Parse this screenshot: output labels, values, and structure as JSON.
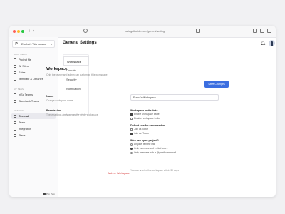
{
  "browser": {
    "url": "partagalbuilder.com/general setting"
  },
  "sidebar": {
    "workspace": {
      "logo": "P",
      "name": "Eunha's Workspace"
    },
    "sections": [
      {
        "title": "MAIN MENU",
        "items": [
          {
            "label": "Project file"
          },
          {
            "label": "All Sites"
          },
          {
            "label": "Sales"
          },
          {
            "label": "Template & Libraries"
          }
        ]
      },
      {
        "title": "MY TEAM",
        "items": [
          {
            "label": "IriSq Teams"
          },
          {
            "label": "Shopifank Teams"
          }
        ]
      },
      {
        "title": "SETTING",
        "items": [
          {
            "label": "General"
          },
          {
            "label": "Team"
          },
          {
            "label": "Integration"
          },
          {
            "label": "Plans"
          }
        ]
      }
    ],
    "user": {
      "name": "Pim Pam"
    }
  },
  "header": {
    "title": "General Settings"
  },
  "subnav": {
    "tabs": [
      {
        "label": "Workspace"
      },
      {
        "label": "Domain"
      },
      {
        "label": "Security"
      },
      {
        "label": "Notification"
      }
    ]
  },
  "workspace": {
    "title": "Workspace",
    "subtitle": "Only the owner and admin can customize this workspace",
    "save_label": "Save Changes",
    "name_label": "Name",
    "name_help": "Change workspace name",
    "name_value": "Eunha's Workspace",
    "permission_label": "Permission",
    "permission_help": "These settings apply across the whole workspace",
    "invite": {
      "title": "Workspace invite links",
      "options": [
        "Enable workspace invite",
        "Disable workspace invite"
      ],
      "selected": 0
    },
    "default_role": {
      "title": "Default role for new member",
      "options": [
        "Join as Editor",
        "Join as Viewer"
      ],
      "selected": 1
    },
    "open_project": {
      "title": "Who can open project?",
      "options": [
        "Anyone with the link",
        "Only members and invited users",
        "Only members with a @gmail.com email"
      ],
      "selected": 1
    },
    "archive_label": "Archive Workspace",
    "archive_help": "You can archive this workspace within 30 days"
  },
  "colors": {
    "accent": "#3b6ee0",
    "danger": "#d63a3a"
  }
}
